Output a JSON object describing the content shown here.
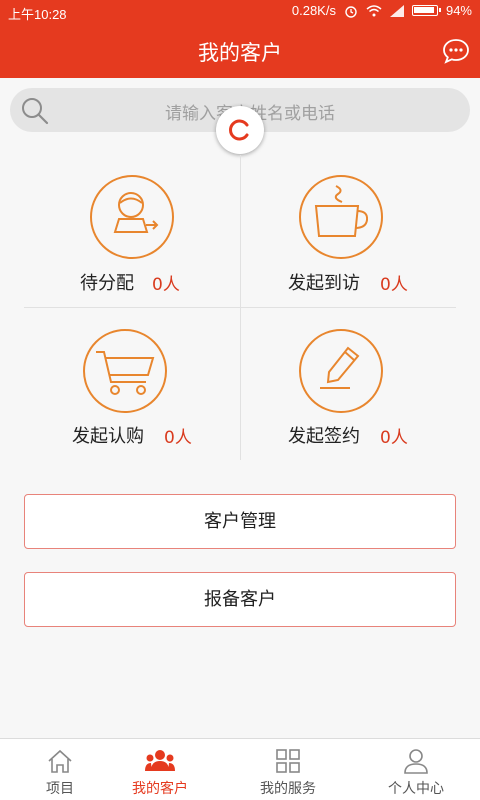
{
  "status_bar": {
    "time": "上午10:28",
    "net_speed": "0.28K/s",
    "battery": "94%"
  },
  "header": {
    "title": "我的客户",
    "chat_icon": "chat-bubble-icon"
  },
  "search": {
    "placeholder": "请输入客户姓名或电话",
    "icon": "search-icon"
  },
  "grid": [
    {
      "label": "待分配",
      "count": "0人",
      "icon": "assign-person-icon"
    },
    {
      "label": "发起到访",
      "count": "0人",
      "icon": "coffee-cup-icon"
    },
    {
      "label": "发起认购",
      "count": "0人",
      "icon": "shopping-cart-icon"
    },
    {
      "label": "发起签约",
      "count": "0人",
      "icon": "pen-sign-icon"
    }
  ],
  "buttons": {
    "customer_manage": "客户管理",
    "report_customer": "报备客户"
  },
  "tabs": [
    {
      "label": "项目",
      "icon": "home-icon"
    },
    {
      "label": "我的客户",
      "icon": "people-icon",
      "active": true
    },
    {
      "label": "我的服务",
      "icon": "grid-icon"
    },
    {
      "label": "个人中心",
      "icon": "person-icon"
    }
  ],
  "colors": {
    "brand": "#e53a1f",
    "accent_orange": "#e8862e",
    "count_red": "#d93b1f"
  }
}
